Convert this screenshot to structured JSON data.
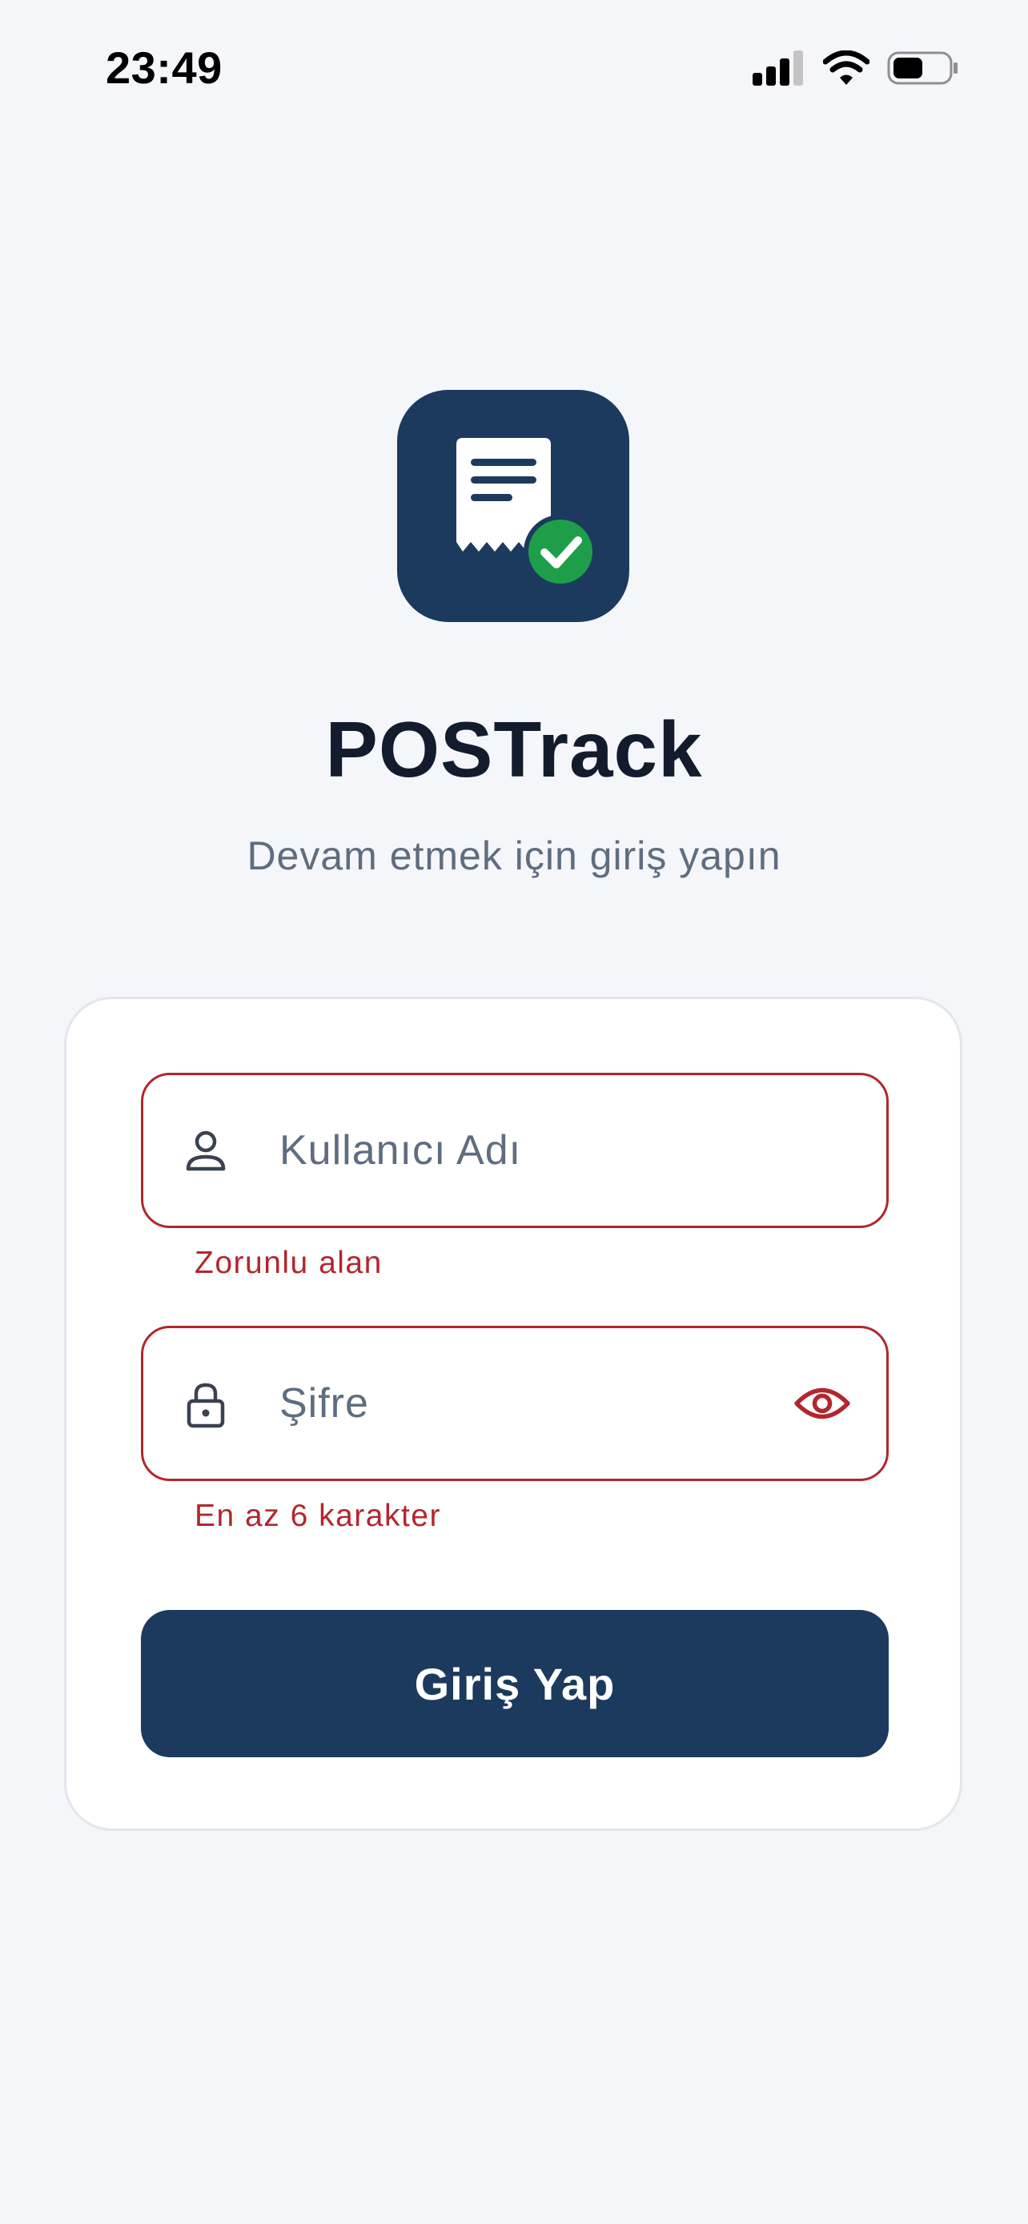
{
  "status_bar": {
    "time": "23:49",
    "icons": [
      "cellular-signal-icon",
      "wifi-icon",
      "battery-icon"
    ]
  },
  "app": {
    "icon": "receipt-check-icon",
    "name": "POSTrack",
    "subtitle": "Devam etmek için giriş yapın"
  },
  "login_form": {
    "username": {
      "icon": "user-icon",
      "value": "",
      "placeholder": "Kullanıcı Adı",
      "error": "Zorunlu alan"
    },
    "password": {
      "icon": "lock-icon",
      "value": "",
      "placeholder": "Şifre",
      "toggle_icon": "eye-icon",
      "error": "En az 6 karakter"
    },
    "submit_label": "Giriş Yap"
  },
  "colors": {
    "background": "#f4f6fa",
    "brand": "#1c3a5e",
    "error": "#b3262e",
    "success": "#1e9e48",
    "title": "#121c2c",
    "muted_text": "#5f6d80"
  }
}
